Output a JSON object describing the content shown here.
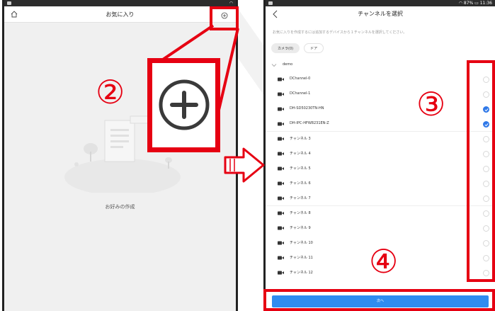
{
  "left_screen": {
    "title": "お気に入り",
    "empty_text": "お好みの作成",
    "icons": {
      "home": "home-icon",
      "add": "add-circle-icon"
    }
  },
  "right_screen": {
    "title": "チャンネルを選択",
    "instruction": "お気に入りを作成するには追加するデバイスから１チャンネルを選択してください。",
    "filter_tabs": [
      {
        "label": "カメラ(0)",
        "active": true
      },
      {
        "label": "ドア",
        "active": false
      }
    ],
    "group": {
      "label": "demo",
      "expanded": true
    },
    "channels": [
      {
        "label": "DChannel-0",
        "checked": false
      },
      {
        "label": "DChannel-1",
        "checked": false
      },
      {
        "label": "DH-SD50230TN-HN",
        "checked": true
      },
      {
        "label": "DH-IPC-HFW8231EN-Z",
        "checked": true
      },
      {
        "label": "チャンネル 3",
        "checked": false
      },
      {
        "label": "チャンネル 4",
        "checked": false
      },
      {
        "label": "チャンネル 5",
        "checked": false
      },
      {
        "label": "チャンネル 6",
        "checked": false
      },
      {
        "label": "チャンネル 7",
        "checked": false
      },
      {
        "label": "チャンネル 8",
        "checked": false
      },
      {
        "label": "チャンネル 9",
        "checked": false
      },
      {
        "label": "チャンネル 10",
        "checked": false
      },
      {
        "label": "チャンネル 11",
        "checked": false
      },
      {
        "label": "チャンネル 12",
        "checked": false
      }
    ],
    "next_label": "次へ",
    "status_bar": {
      "battery": "87%",
      "time": "11:36"
    }
  },
  "annotations": {
    "step2": "②",
    "step3": "③",
    "step4": "④"
  },
  "colors": {
    "annotation_red": "#e60012",
    "accent_blue": "#2f8cf0",
    "check_blue": "#2f78e8"
  }
}
